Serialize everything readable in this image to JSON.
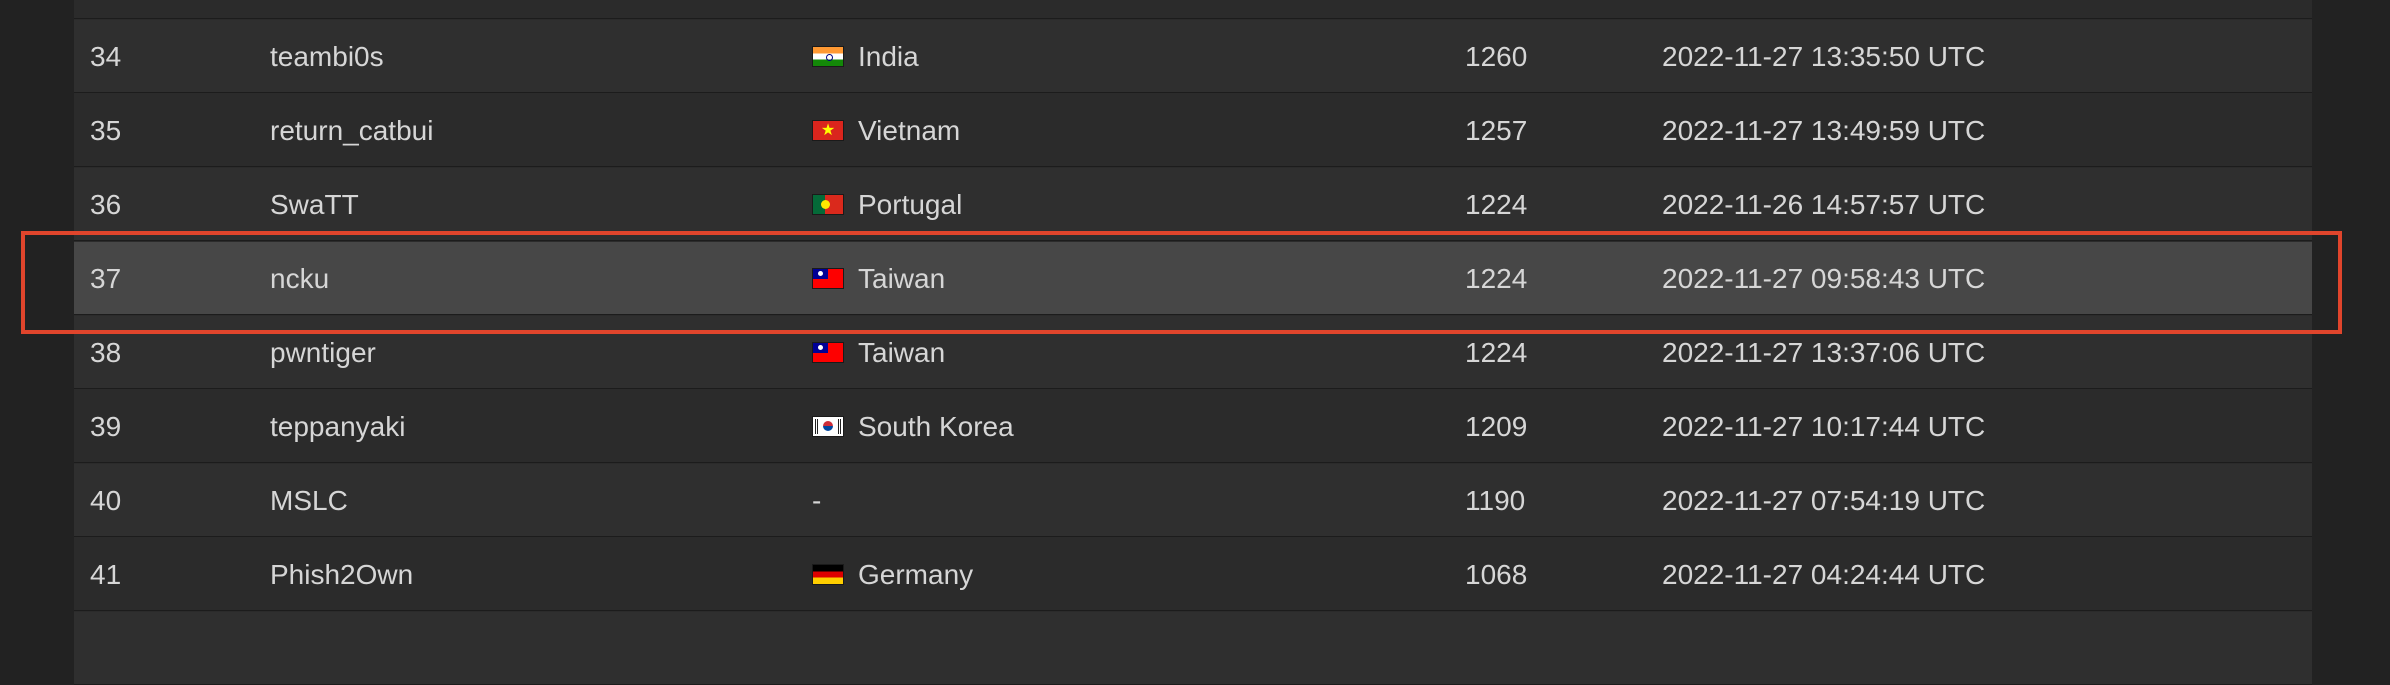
{
  "scoreboard": {
    "rows": [
      {
        "rank": "",
        "team": "",
        "country": "",
        "flag": "",
        "score": "",
        "time": ""
      },
      {
        "rank": "34",
        "team": "teambi0s",
        "country": "India",
        "flag": "india-flag-icon",
        "score": "1260",
        "time": "2022-11-27 13:35:50 UTC"
      },
      {
        "rank": "35",
        "team": "return_catbui",
        "country": "Vietnam",
        "flag": "vietnam-flag-icon",
        "score": "1257",
        "time": "2022-11-27 13:49:59 UTC"
      },
      {
        "rank": "36",
        "team": "SwaTT",
        "country": "Portugal",
        "flag": "portugal-flag-icon",
        "score": "1224",
        "time": "2022-11-26 14:57:57 UTC"
      },
      {
        "rank": "37",
        "team": "ncku",
        "country": "Taiwan",
        "flag": "taiwan-flag-icon",
        "score": "1224",
        "time": "2022-11-27 09:58:43 UTC"
      },
      {
        "rank": "38",
        "team": "pwntiger",
        "country": "Taiwan",
        "flag": "taiwan-flag-icon",
        "score": "1224",
        "time": "2022-11-27 13:37:06 UTC"
      },
      {
        "rank": "39",
        "team": "teppanyaki",
        "country": "South Korea",
        "flag": "south-korea-flag-icon",
        "score": "1209",
        "time": "2022-11-27 10:17:44 UTC"
      },
      {
        "rank": "40",
        "team": "MSLC",
        "country": "-",
        "flag": "",
        "score": "1190",
        "time": "2022-11-27 07:54:19 UTC"
      },
      {
        "rank": "41",
        "team": "Phish2Own",
        "country": "Germany",
        "flag": "germany-flag-icon",
        "score": "1068",
        "time": "2022-11-27 04:24:44 UTC"
      }
    ],
    "highlighted_rank": "37"
  },
  "colors": {
    "page_background": "#222222",
    "row_background": "#2b2b2b",
    "row_alt_background": "#2f2f2f",
    "highlight_row_background": "#474747",
    "highlight_outline": "#e0452c",
    "text": "#d6d6d6"
  }
}
